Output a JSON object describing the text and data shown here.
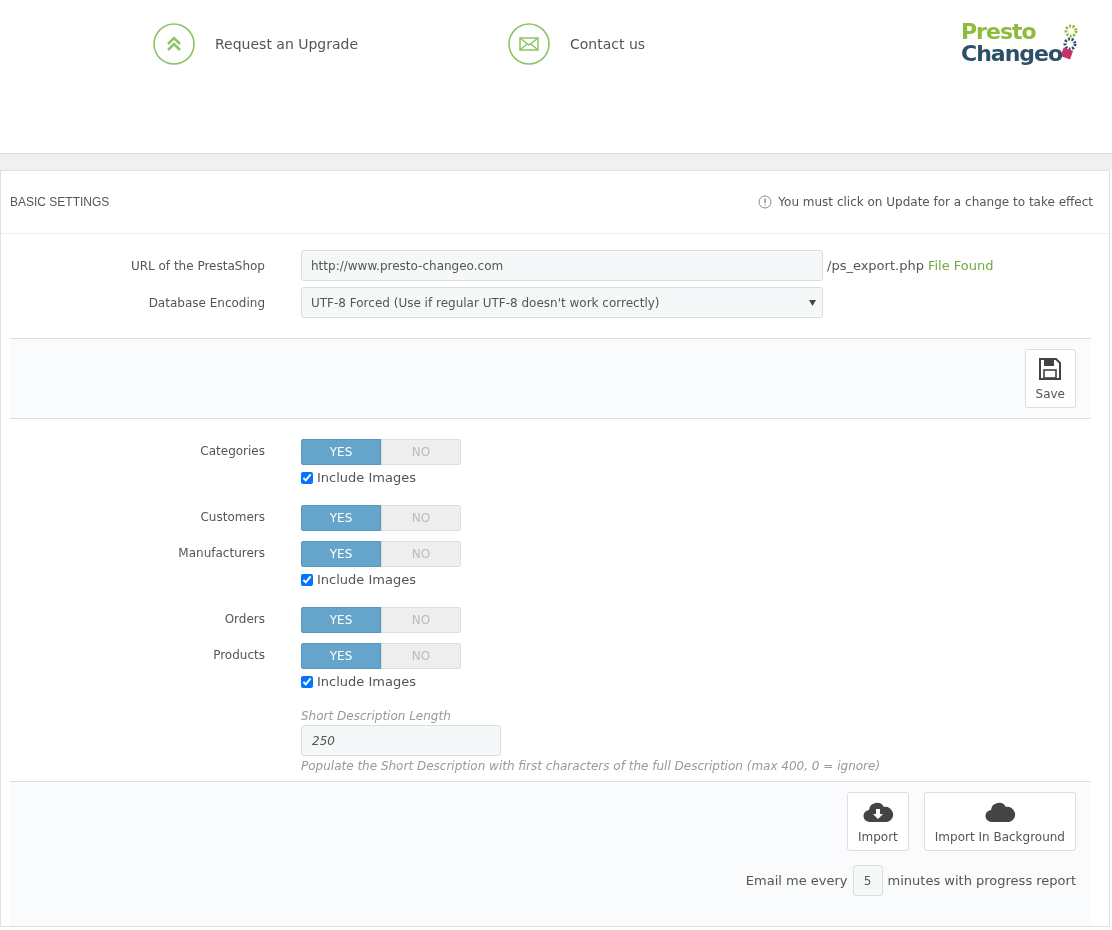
{
  "header": {
    "links": [
      {
        "kind": "upgrade",
        "label": "Request an Upgrade"
      },
      {
        "kind": "contact",
        "label": "Contact us"
      }
    ],
    "logo": {
      "line_1": "Presto",
      "line_2": "Changeo"
    }
  },
  "panel": {
    "title": "BASIC SETTINGS",
    "notice": "You must click on Update for a change to take effect",
    "url": {
      "label": "URL of the PrestaShop",
      "value": "http://www.presto-changeo.com",
      "suffix": "/ps_export.php",
      "status": "File Found"
    },
    "encoding": {
      "label": "Database Encoding",
      "value": "UTF-8 Forced (Use if regular UTF-8 doesn't work correctly)"
    },
    "save_button": "Save",
    "entities": [
      {
        "label": "Categories",
        "yes": "YES",
        "no": "NO",
        "enabled": true,
        "include_images": {
          "label": "Include Images",
          "checked": true
        }
      },
      {
        "label": "Customers",
        "yes": "YES",
        "no": "NO",
        "enabled": true
      },
      {
        "label": "Manufacturers",
        "yes": "YES",
        "no": "NO",
        "enabled": true,
        "include_images": {
          "label": "Include Images",
          "checked": true
        }
      },
      {
        "label": "Orders",
        "yes": "YES",
        "no": "NO",
        "enabled": true
      },
      {
        "label": "Products",
        "yes": "YES",
        "no": "NO",
        "enabled": true,
        "include_images": {
          "label": "Include Images",
          "checked": true
        }
      }
    ],
    "short_description": {
      "label": "Short Description Length",
      "value": "250",
      "help": "Populate the Short Description with first characters of the full Description (max 400, 0 = ignore)"
    },
    "buttons": [
      {
        "kind": "import",
        "label": "Import"
      },
      {
        "kind": "background",
        "label": "Import In Background"
      }
    ],
    "email": {
      "before": "Email me every",
      "value": "5",
      "after": "minutes with progress report"
    }
  }
}
